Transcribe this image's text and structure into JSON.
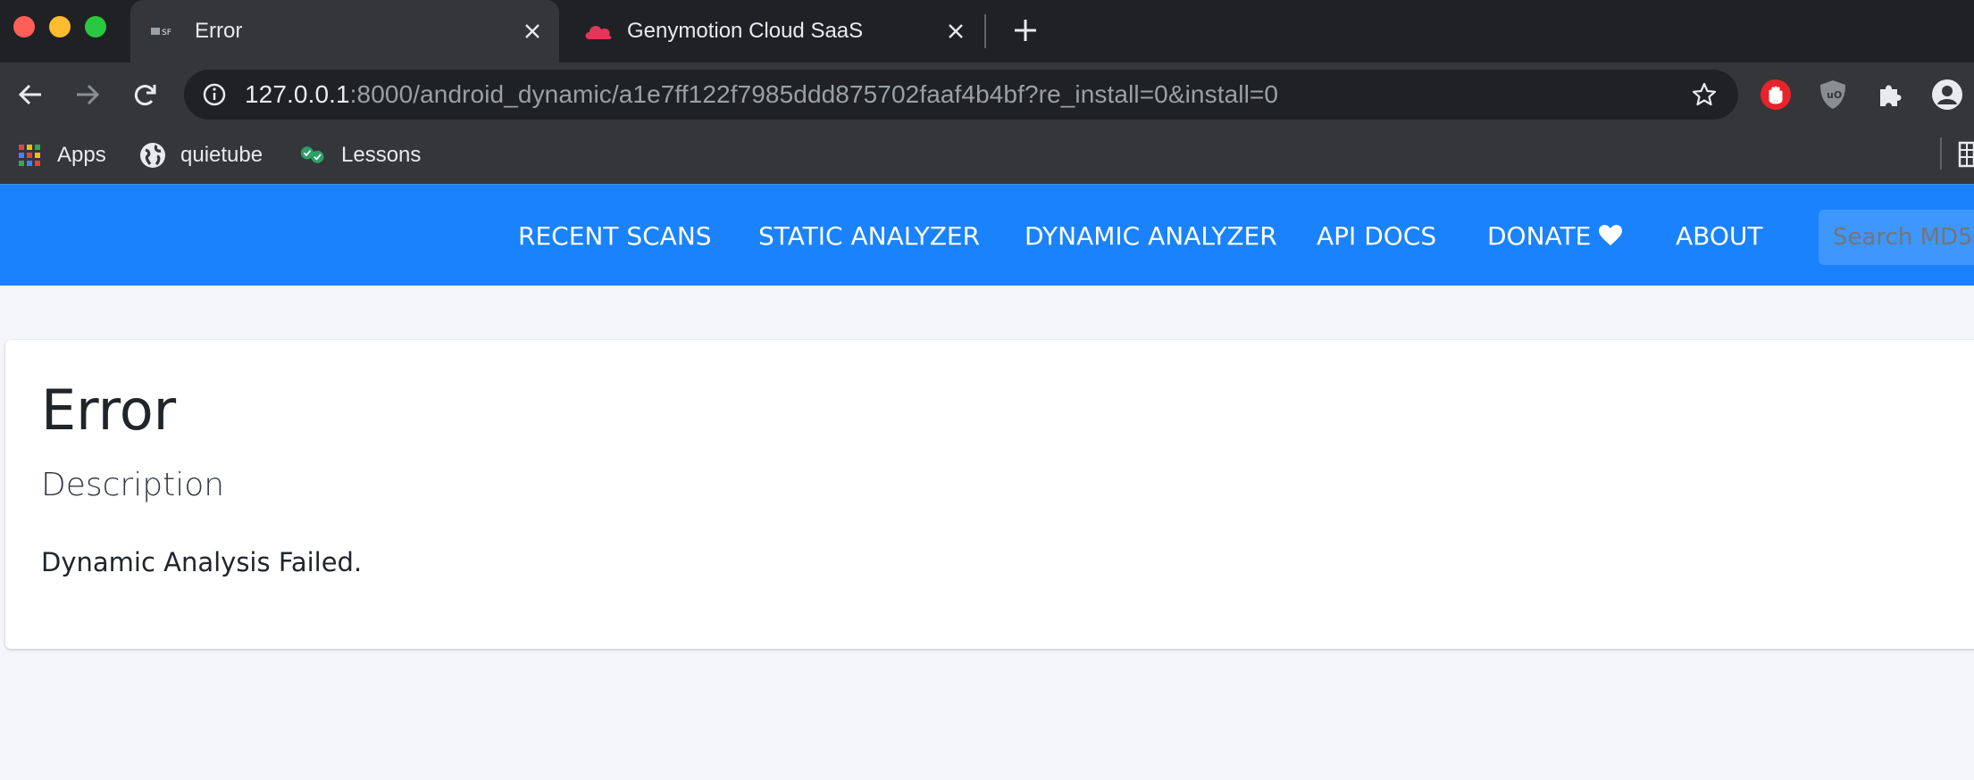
{
  "browser": {
    "tabs": [
      {
        "title": "Error",
        "favicon": "mobsf-favicon",
        "active": true
      },
      {
        "title": "Genymotion Cloud SaaS",
        "favicon": "genymotion-cloud-favicon",
        "active": false
      }
    ],
    "url": {
      "host": "127.0.0.1",
      "path": ":8000/android_dynamic/a1e7ff122f7985ddd875702faaf4b4bf?re_install=0&install=0"
    },
    "bookmarks": [
      {
        "label": "Apps",
        "icon": "apps-grid-icon"
      },
      {
        "label": "quietube",
        "icon": "globe-icon"
      },
      {
        "label": "Lessons",
        "icon": "checkmarks-icon"
      }
    ],
    "extensions": [
      "adblock-hand-icon",
      "ublock-icon",
      "puzzle-icon",
      "profile-icon"
    ]
  },
  "navbar": {
    "links": [
      "RECENT SCANS",
      "STATIC ANALYZER",
      "DYNAMIC ANALYZER",
      "API DOCS",
      "DONATE",
      "ABOUT"
    ],
    "search_placeholder": "Search MD5"
  },
  "card": {
    "title": "Error",
    "subtitle": "Description",
    "message": "Dynamic Analysis Failed."
  },
  "colors": {
    "navbar": "#1a82fc",
    "page_bg": "#f4f6f9",
    "chrome_dark": "#202124",
    "chrome_toolbar": "#35363a"
  }
}
